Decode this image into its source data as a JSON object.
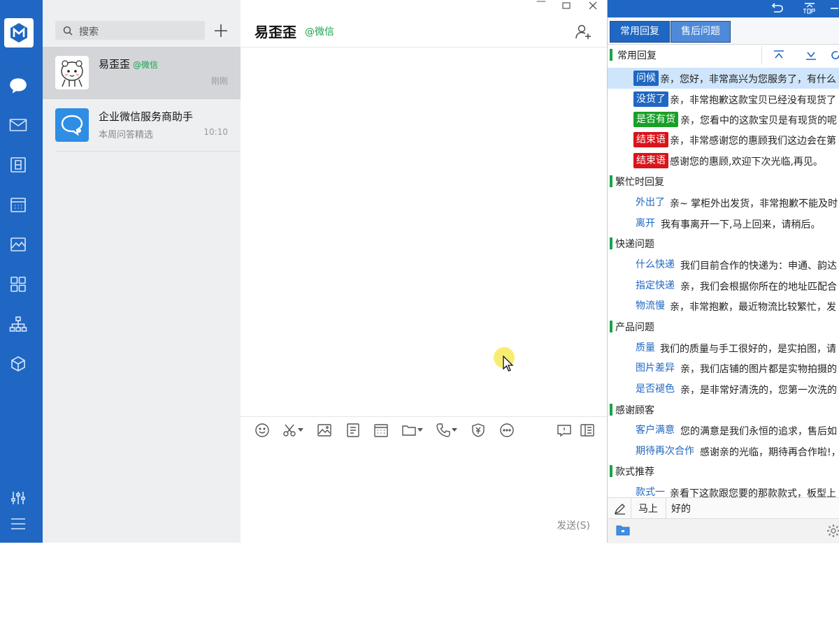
{
  "conversation_list": {
    "search": {
      "placeholder": "搜索"
    },
    "items": [
      {
        "name": "易歪歪",
        "source": "@微信",
        "last_message": "",
        "time": "刚刚",
        "active": true
      },
      {
        "name": "企业微信服务商助手",
        "source": "",
        "last_message": "本周问答精选",
        "time": "10:10",
        "active": false
      }
    ]
  },
  "chat": {
    "title": "易歪歪",
    "title_source": "@微信",
    "send_label": "发送(S)"
  },
  "quick_reply": {
    "tabs": [
      "常用回复",
      "售后问题"
    ],
    "categories": [
      {
        "name": "常用回复",
        "rows": [
          {
            "keyword": "问候",
            "text": "亲，您好，非常高兴为您服务了，有什么",
            "color": "#1f67c2",
            "selected": true
          },
          {
            "keyword": "没货了",
            "text": "亲，非常抱歉这款宝贝已经没有现货了",
            "color": "#1f67c2"
          },
          {
            "keyword": "是否有货",
            "text": "亲，您看中的这款宝贝是有现货的呢",
            "color": "#18a025"
          },
          {
            "keyword": "结束语",
            "text": "亲，非常感谢您的惠顾我们这边会在第",
            "color": "#d9141b"
          },
          {
            "keyword": "结束语",
            "text": "感谢您的惠顾,欢迎下次光临,再见。",
            "color": "#d9141b"
          }
        ]
      },
      {
        "name": "繁忙时回复",
        "rows": [
          {
            "keyword": "外出了",
            "text": "亲~ 掌柜外出发货，非常抱歉不能及时",
            "color": ""
          },
          {
            "keyword": "离开",
            "text": "我有事离开一下,马上回来，请稍后。",
            "color": ""
          }
        ]
      },
      {
        "name": "快递问题",
        "rows": [
          {
            "keyword": "什么快递",
            "text": "我们目前合作的快递为：申通、韵达",
            "color": ""
          },
          {
            "keyword": "指定快递",
            "text": "亲，我们会根据你所在的地址匹配合",
            "color": ""
          },
          {
            "keyword": "物流慢",
            "text": "亲，非常抱歉，最近物流比较繁忙，发",
            "color": ""
          }
        ]
      },
      {
        "name": "产品问题",
        "rows": [
          {
            "keyword": "质量",
            "text": "我们的质量与手工很好的，是实拍图，请",
            "color": ""
          },
          {
            "keyword": "图片差异",
            "text": "亲，我们店铺的图片都是实物拍摄的",
            "color": ""
          },
          {
            "keyword": "是否褪色",
            "text": "亲，是非常好清洗的，您第一次洗的",
            "color": ""
          }
        ]
      },
      {
        "name": "感谢顾客",
        "rows": [
          {
            "keyword": "客户满意",
            "text": "您的满意是我们永恒的追求，售后如",
            "color": ""
          },
          {
            "keyword": "期待再次合作",
            "text": "感谢亲的光临，期待再合作啦!，",
            "color": ""
          }
        ]
      },
      {
        "name": "款式推荐",
        "rows": [
          {
            "keyword": "款式一",
            "text": "亲看下这款跟您要的那款款式，板型上",
            "color": ""
          }
        ]
      }
    ],
    "bottom_words": [
      "马上",
      "好的"
    ]
  },
  "colors": {
    "brand": "#1f67c2",
    "wechat_green": "#1aa34a"
  }
}
